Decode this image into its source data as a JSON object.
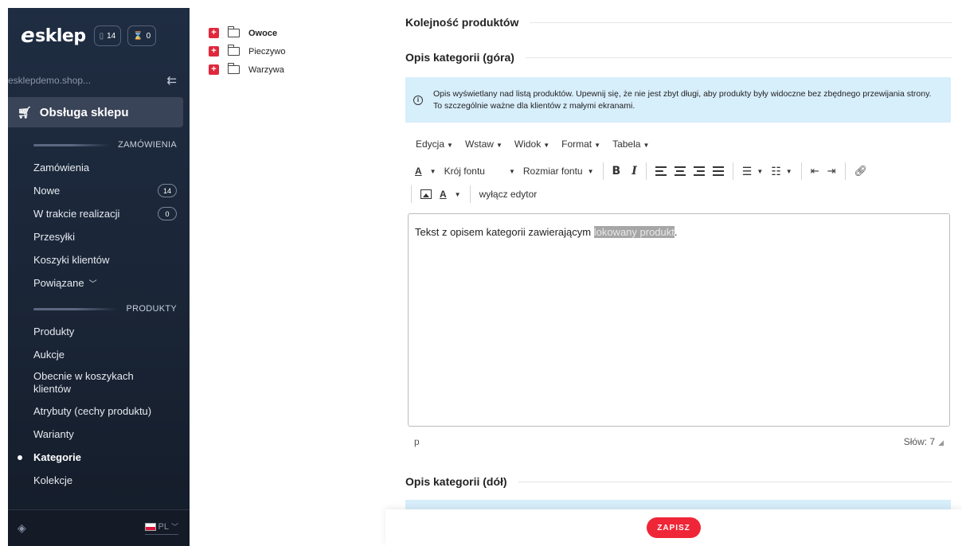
{
  "sidebar": {
    "logo": "sklep",
    "header_badges": [
      {
        "icon": "document-icon",
        "count": "14"
      },
      {
        "icon": "hourglass-icon",
        "count": "0"
      }
    ],
    "shop_name": "esklepdemo.shop...",
    "main_section": "Obsługa sklepu",
    "groups": [
      {
        "title": "ZAMÓWIENIA",
        "items": [
          {
            "label": "Zamówienia"
          },
          {
            "label": "Nowe",
            "count": "14"
          },
          {
            "label": "W trakcie realizacji",
            "count": "0"
          },
          {
            "label": "Przesyłki"
          },
          {
            "label": "Koszyki klientów"
          },
          {
            "label": "Powiązane"
          }
        ]
      },
      {
        "title": "PRODUKTY",
        "items": [
          {
            "label": "Produkty"
          },
          {
            "label": "Aukcje"
          },
          {
            "label": "Obecnie w koszykach klientów"
          },
          {
            "label": "Atrybuty (cechy produktu)"
          },
          {
            "label": "Warianty"
          },
          {
            "label": "Kategorie",
            "active": true
          },
          {
            "label": "Kolekcje"
          }
        ]
      }
    ],
    "footer": {
      "language": "PL"
    }
  },
  "tree": {
    "items": [
      {
        "label": "Owoce",
        "bold": true
      },
      {
        "label": "Pieczywo"
      },
      {
        "label": "Warzywa"
      }
    ]
  },
  "main": {
    "order_title": "Kolejność produktów",
    "top_title": "Opis kategorii (góra)",
    "info_text": "Opis wyświetlany nad listą produktów. Upewnij się, że nie jest zbyt długi, aby produkty były widoczne bez zbędnego przewijania strony. To szczególnie ważne dla klientów z małymi ekranami.",
    "bottom_title": "Opis kategorii (dół)"
  },
  "editor": {
    "menu": [
      "Edycja",
      "Wstaw",
      "Widok",
      "Format",
      "Tabela"
    ],
    "font_family_label": "Krój fontu",
    "font_size_label": "Rozmiar fontu",
    "disable_editor_label": "wyłącz edytor",
    "content_prefix": "Tekst z opisem kategorii zawierającym ",
    "content_highlight": "lokowany produkt",
    "content_suffix": ".",
    "status_path": "p",
    "word_count": "Słów: 7"
  },
  "actions": {
    "save_label": "ZAPISZ"
  },
  "colors": {
    "accent": "#ef2637",
    "sidebar_bg": "#1f2d42",
    "info_bg": "#d7eefb"
  }
}
